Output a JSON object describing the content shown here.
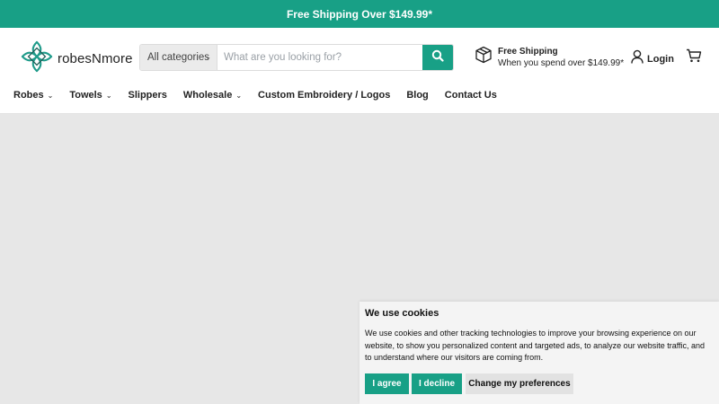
{
  "announcement": {
    "text": "Free Shipping Over $149.99*"
  },
  "brand": {
    "name": "robesNmore",
    "accent_color": "#18a086",
    "logo_icon": "clover-knot-logo"
  },
  "search": {
    "category_label": "All categories",
    "placeholder": "What are you looking for?",
    "value": "",
    "button_icon": "search-icon"
  },
  "shipping_promo": {
    "icon": "box-icon",
    "title": "Free Shipping",
    "subtitle": "When you spend over $149.99*"
  },
  "account": {
    "icon": "user-icon",
    "label": "Login"
  },
  "cart": {
    "icon": "cart-icon"
  },
  "nav": {
    "items": [
      {
        "label": "Robes",
        "has_dropdown": true
      },
      {
        "label": "Towels",
        "has_dropdown": true
      },
      {
        "label": "Slippers",
        "has_dropdown": false
      },
      {
        "label": "Wholesale",
        "has_dropdown": true
      },
      {
        "label": "Custom Embroidery / Logos",
        "has_dropdown": false
      },
      {
        "label": "Blog",
        "has_dropdown": false
      },
      {
        "label": "Contact Us",
        "has_dropdown": false
      }
    ]
  },
  "cookie_banner": {
    "title": "We use cookies",
    "body": "We use cookies and other tracking technologies to improve your browsing experience on our website, to show you personalized content and targeted ads, to analyze our website traffic, and to understand where our visitors are coming from.",
    "agree_label": "I agree",
    "decline_label": "I decline",
    "preferences_label": "Change my preferences"
  }
}
